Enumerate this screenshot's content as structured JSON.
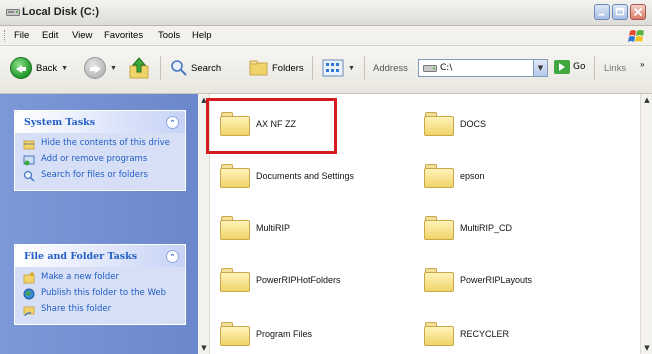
{
  "window": {
    "title": "Local Disk (C:)"
  },
  "menu": [
    "File",
    "Edit",
    "View",
    "Favorites",
    "Tools",
    "Help"
  ],
  "toolbar": {
    "back_label": "Back",
    "search_label": "Search",
    "folders_label": "Folders",
    "address_label": "Address",
    "address_value": "C:\\",
    "go_label": "Go",
    "links_label": "Links"
  },
  "system_tasks": {
    "title": "System Tasks",
    "items": [
      {
        "label": "Hide the contents of this drive",
        "icon": "hide-contents-icon"
      },
      {
        "label": "Add or remove programs",
        "icon": "add-remove-programs-icon"
      },
      {
        "label": "Search for files or folders",
        "icon": "search-icon"
      }
    ]
  },
  "file_tasks": {
    "title": "File and Folder Tasks",
    "items": [
      {
        "label": "Make a new folder",
        "icon": "new-folder-icon"
      },
      {
        "label": "Publish this folder to the Web",
        "icon": "globe-icon"
      },
      {
        "label": "Share this folder",
        "icon": "share-folder-icon"
      }
    ]
  },
  "folders": [
    "AX NF ZZ",
    "DOCS",
    "Documents and Settings",
    "epson",
    "MultiRIP",
    "MultiRIP_CD",
    "PowerRIPHotFolders",
    "PowerRIPLayouts",
    "Program Files",
    "RECYCLER"
  ],
  "colors": {
    "highlight": "#d51b21",
    "task_pane": "#7c98d8",
    "task_text": "#215dc6",
    "folder_fill": "#f0d46a"
  }
}
